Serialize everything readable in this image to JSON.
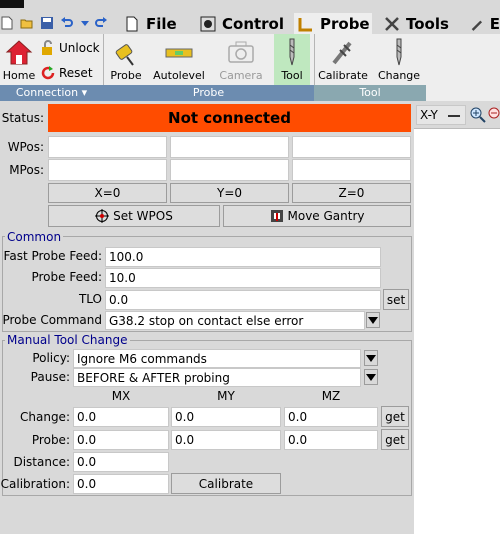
{
  "tabs": [
    {
      "label": "File",
      "icon": "file-icon"
    },
    {
      "label": "Control",
      "icon": "control-icon"
    },
    {
      "label": "Probe",
      "icon": "probe-icon"
    },
    {
      "label": "Tools",
      "icon": "tools-icon"
    },
    {
      "label": "E",
      "icon": "editor-icon"
    }
  ],
  "ribbon": {
    "home": "Home",
    "unlock": "Unlock",
    "reset": "Reset",
    "probe": "Probe",
    "autolevel": "Autolevel",
    "camera": "Camera",
    "tool": "Tool",
    "calibrate": "Calibrate",
    "change": "Change",
    "groups": {
      "connection": "Connection",
      "probe": "Probe",
      "tool": "Tool"
    }
  },
  "status": {
    "label": "Status:",
    "value": "Not connected",
    "color": "#ff4c00"
  },
  "wpos_label": "WPos:",
  "mpos_label": "MPos:",
  "zero": {
    "x": "X=0",
    "y": "Y=0",
    "z": "Z=0"
  },
  "set_wpos": "Set WPOS",
  "move_gantry": "Move Gantry",
  "common": {
    "title": "Common",
    "fast_probe_feed_label": "Fast Probe Feed:",
    "fast_probe_feed": "100.0",
    "probe_feed_label": "Probe Feed:",
    "probe_feed": "10.0",
    "tlo_label": "TLO",
    "tlo": "0.0",
    "set": "set",
    "probe_command_label": "Probe Command",
    "probe_command": "G38.2 stop on contact else error"
  },
  "manual": {
    "title": "Manual Tool Change",
    "policy_label": "Policy:",
    "policy": "Ignore M6 commands",
    "pause_label": "Pause:",
    "pause": "BEFORE & AFTER probing",
    "col_mx": "MX",
    "col_my": "MY",
    "col_mz": "MZ",
    "change_label": "Change:",
    "change": [
      "0.0",
      "0.0",
      "0.0"
    ],
    "probe_label": "Probe:",
    "probe": [
      "0.0",
      "0.0",
      "0.0"
    ],
    "get": "get",
    "distance_label": "Distance:",
    "distance": "0.0",
    "calibration_label": "Calibration:",
    "calibration": "0.0",
    "calibrate_button": "Calibrate"
  },
  "view": {
    "plane": "X-Y"
  }
}
